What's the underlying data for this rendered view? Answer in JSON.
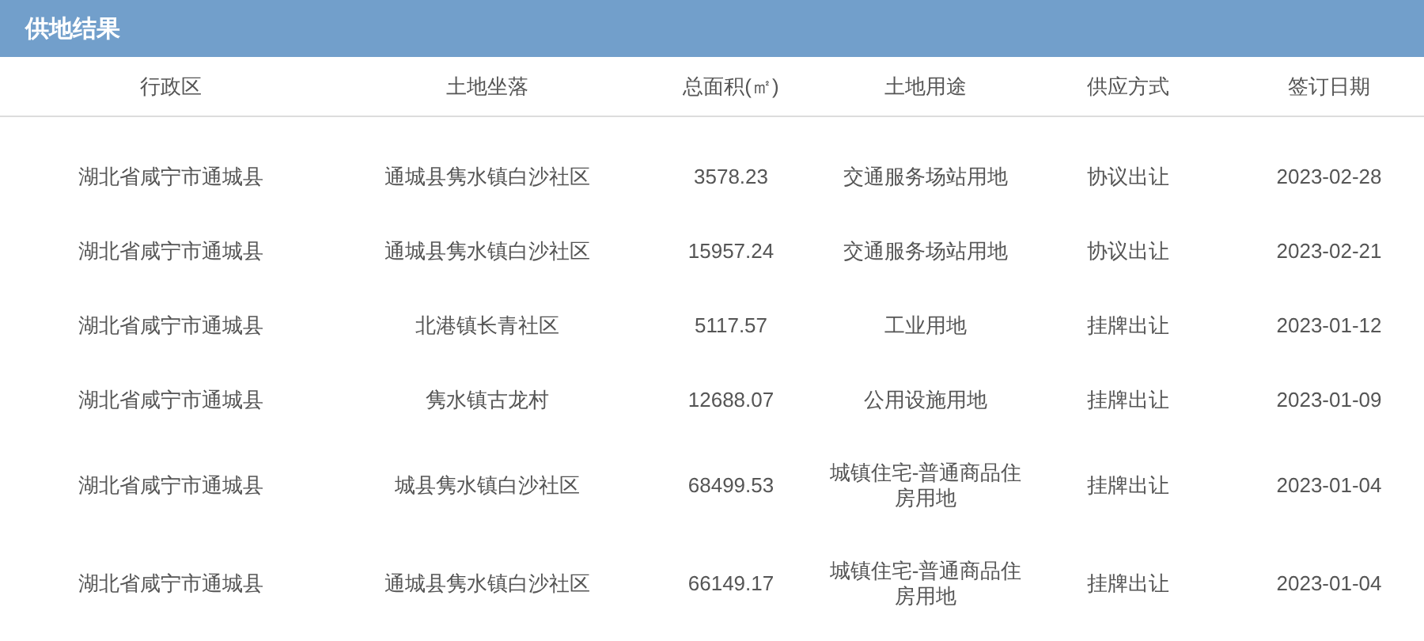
{
  "panel": {
    "title": "供地结果"
  },
  "table": {
    "columns": [
      "行政区",
      "土地坐落",
      "总面积(㎡)",
      "土地用途",
      "供应方式",
      "签订日期"
    ],
    "rows": [
      [
        "湖北省咸宁市通城县",
        "通城县隽水镇白沙社区",
        "3578.23",
        "交通服务场站用地",
        "协议出让",
        "2023-02-28"
      ],
      [
        "湖北省咸宁市通城县",
        "通城县隽水镇白沙社区",
        "15957.24",
        "交通服务场站用地",
        "协议出让",
        "2023-02-21"
      ],
      [
        "湖北省咸宁市通城县",
        "北港镇长青社区",
        "5117.57",
        "工业用地",
        "挂牌出让",
        "2023-01-12"
      ],
      [
        "湖北省咸宁市通城县",
        "隽水镇古龙村",
        "12688.07",
        "公用设施用地",
        "挂牌出让",
        "2023-01-09"
      ],
      [
        "湖北省咸宁市通城县",
        "城县隽水镇白沙社区",
        "68499.53",
        "城镇住宅-普通商品住房用地",
        "挂牌出让",
        "2023-01-04"
      ],
      [
        "湖北省咸宁市通城县",
        "通城县隽水镇白沙社区",
        "66149.17",
        "城镇住宅-普通商品住房用地",
        "挂牌出让",
        "2023-01-04"
      ]
    ]
  }
}
